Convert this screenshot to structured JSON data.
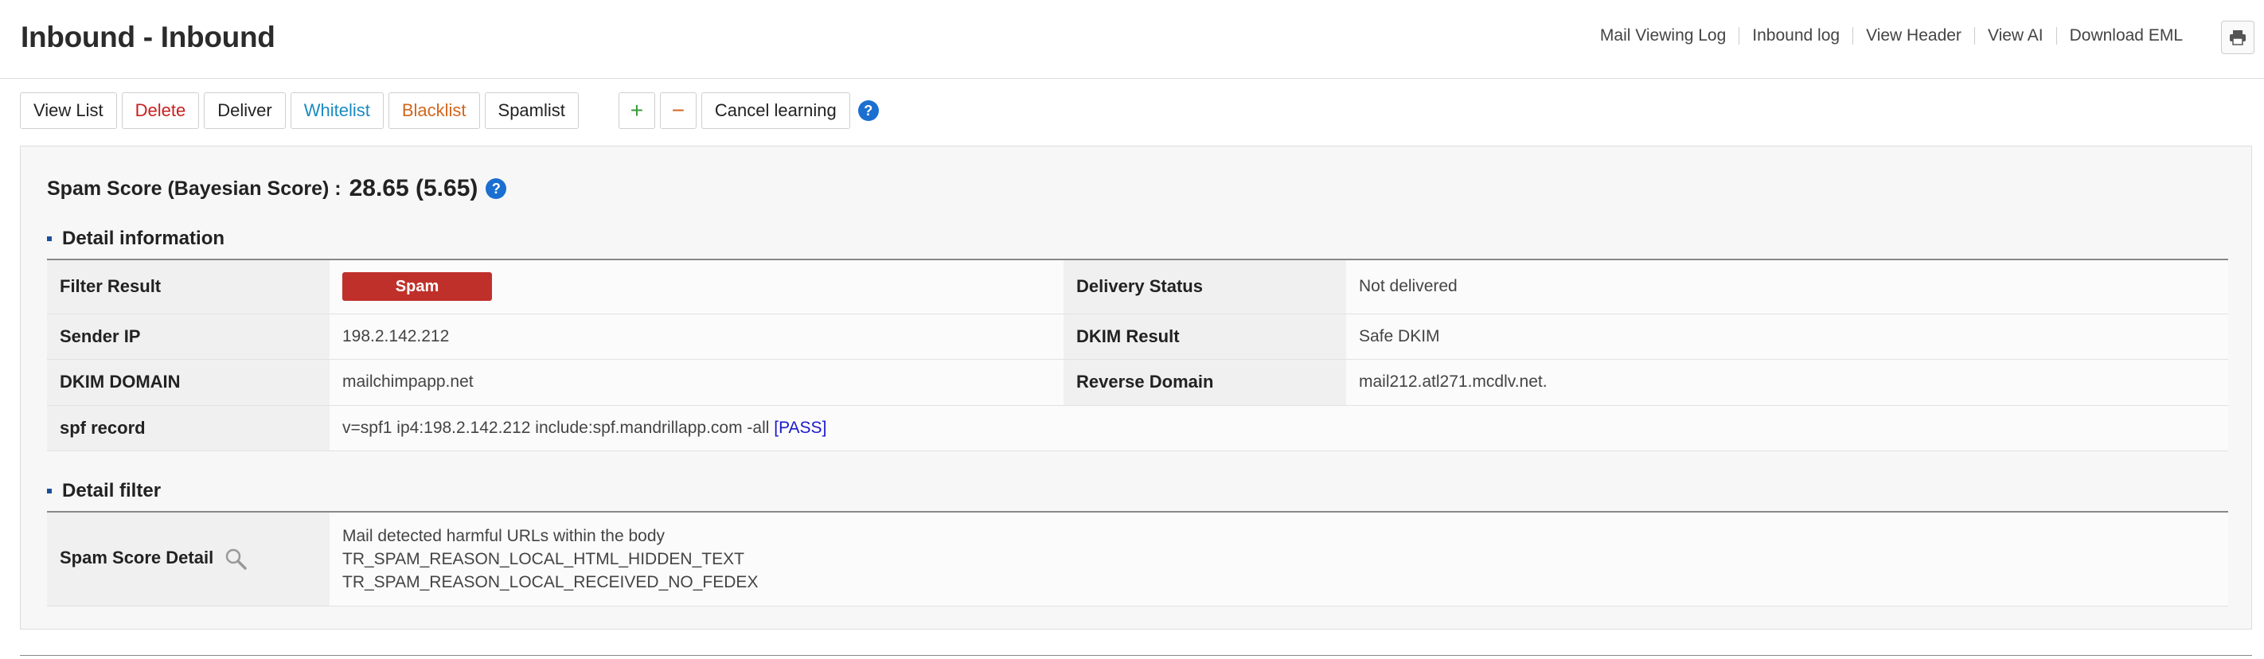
{
  "header": {
    "title": "Inbound - Inbound",
    "links": [
      "Mail Viewing Log",
      "Inbound log",
      "View Header",
      "View AI",
      "Download EML"
    ],
    "print_icon": "printer-icon"
  },
  "toolbar": {
    "view_list": "View List",
    "delete": "Delete",
    "deliver": "Deliver",
    "whitelist": "Whitelist",
    "blacklist": "Blacklist",
    "spamlist": "Spamlist",
    "plus": "+",
    "minus": "−",
    "cancel_learning": "Cancel learning",
    "help": "?"
  },
  "score": {
    "label": "Spam Score (Bayesian Score) :",
    "value": "28.65 (5.65)",
    "help": "?"
  },
  "detail_info": {
    "title": "Detail information",
    "filter_result_label": "Filter Result",
    "filter_result_value": "Spam",
    "delivery_status_label": "Delivery Status",
    "delivery_status_value": "Not delivered",
    "sender_ip_label": "Sender IP",
    "sender_ip_value": "198.2.142.212",
    "dkim_result_label": "DKIM Result",
    "dkim_result_value": "Safe DKIM",
    "dkim_domain_label": "DKIM DOMAIN",
    "dkim_domain_value": "mailchimpapp.net",
    "reverse_domain_label": "Reverse Domain",
    "reverse_domain_value": "mail212.atl271.mcdlv.net.",
    "spf_label": "spf record",
    "spf_value": "v=spf1 ip4:198.2.142.212 include:spf.mandrillapp.com -all",
    "spf_status": "[PASS]"
  },
  "detail_filter": {
    "title": "Detail filter",
    "label": "Spam Score Detail",
    "lines": [
      "Mail detected harmful URLs within the body",
      "TR_SPAM_REASON_LOCAL_HTML_HIDDEN_TEXT",
      "TR_SPAM_REASON_LOCAL_RECEIVED_NO_FEDEX"
    ]
  },
  "colors": {
    "spam_badge": "#c0302a",
    "not_delivered": "#e0531f",
    "pass": "#1a1acc",
    "help_blue": "#1b6fd0"
  }
}
